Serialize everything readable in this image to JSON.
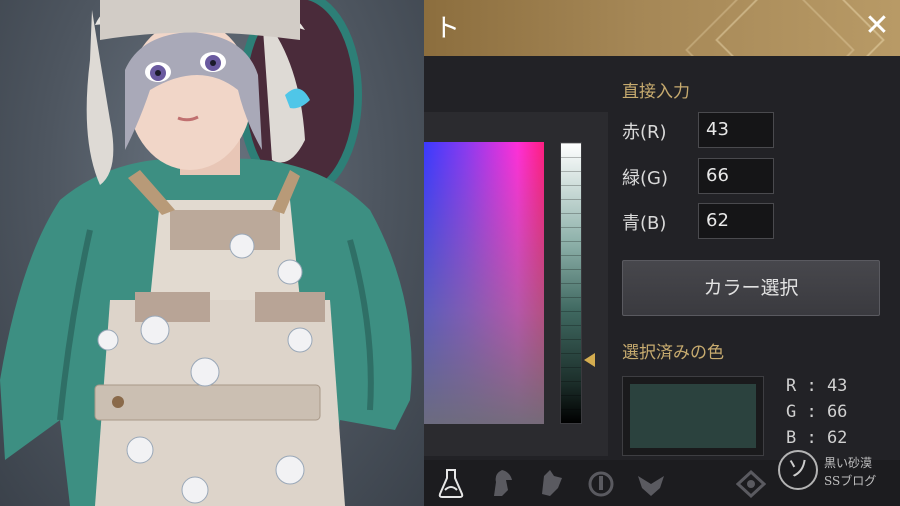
{
  "window": {
    "title_fragment": "ト",
    "close_glyph": "✕"
  },
  "direct_input": {
    "label": "直接入力",
    "rows": [
      {
        "name": "赤(R)",
        "value": "43"
      },
      {
        "name": "緑(G)",
        "value": "66"
      },
      {
        "name": "青(B)",
        "value": "62"
      }
    ]
  },
  "color_select_button": "カラー選択",
  "selected": {
    "label": "選択済みの色",
    "color": "#2b423e",
    "r_text": "R : 43",
    "g_text": "G : 66",
    "b_text": "B : 62"
  },
  "bottom_icons": [
    "flask-icon",
    "horse-head-icon",
    "wolf-head-icon",
    "compass-circle-icon",
    "eagle-crest-icon",
    "moon-crescent-icon",
    "eye-emblem-icon"
  ],
  "watermark": {
    "symbol": "ソ",
    "line1": "黒い砂漠",
    "line2": "SSブログ"
  },
  "colors": {
    "accent_gold": "#c7ab6f",
    "title_bar": "#a58756",
    "panel_bg": "#222226"
  }
}
